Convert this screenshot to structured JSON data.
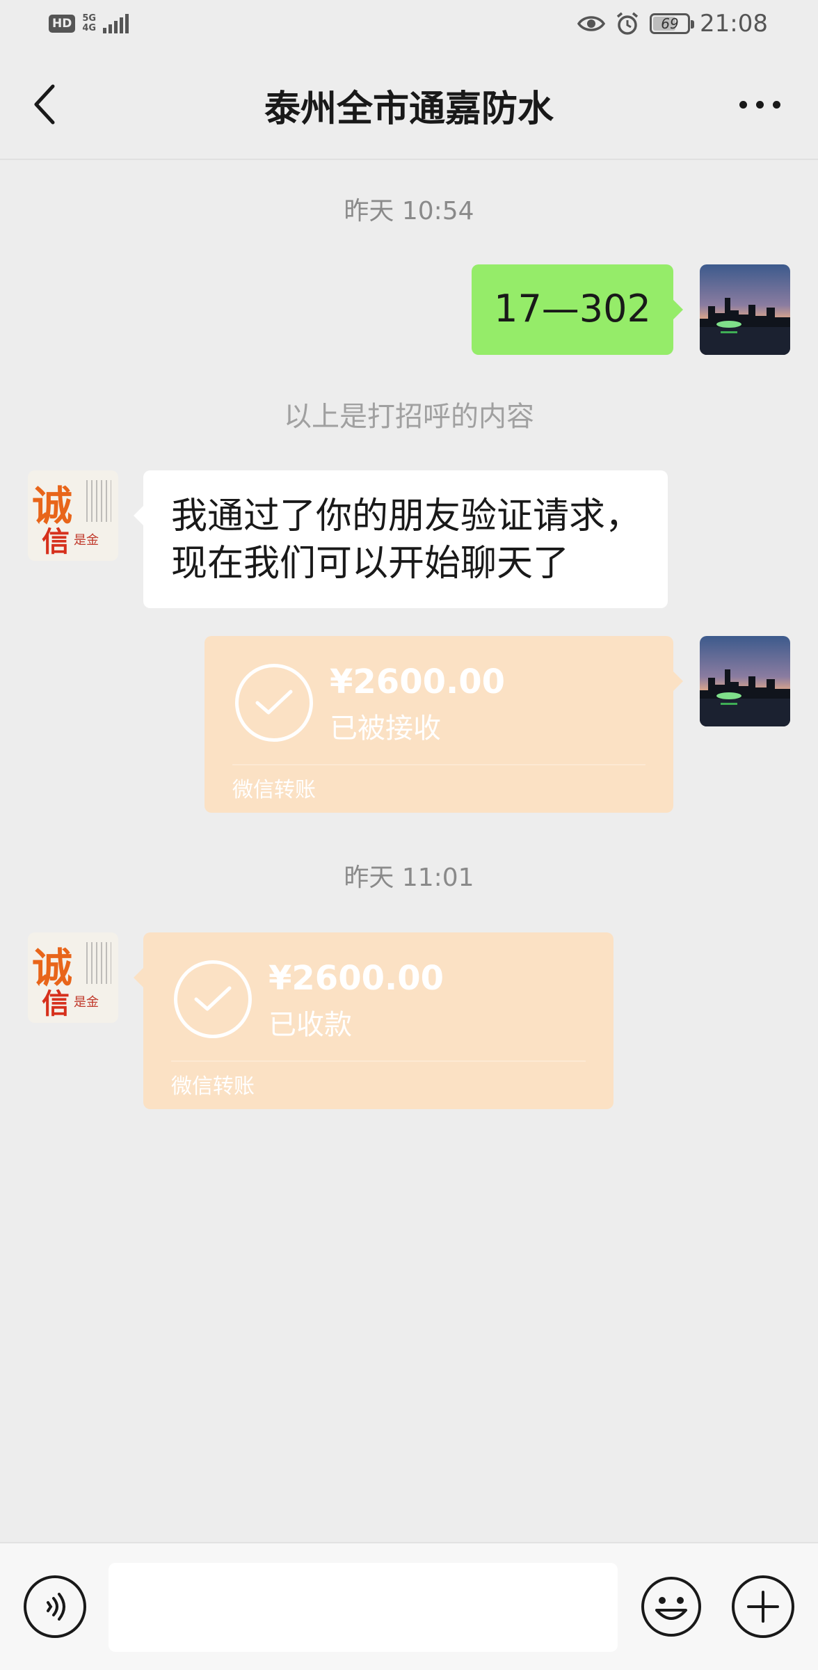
{
  "status_bar": {
    "hd": "HD",
    "network": "5G",
    "network_sub": "4G",
    "battery": "69",
    "battery_level": 0.69,
    "time": "21:08",
    "icons": [
      "eye-icon",
      "alarm-icon",
      "battery-icon"
    ]
  },
  "header": {
    "title": "泰州全市通嘉防水",
    "back_icon": "chevron-left-icon",
    "more_icon": "more-dots-icon"
  },
  "chat": {
    "time_1": "昨天 10:54",
    "msg_out_1": "17—302",
    "system_msg": "以上是打招呼的内容",
    "msg_in_1": "我通过了你的朋友验证请求，现在我们可以开始聊天了",
    "transfer_1": {
      "amount": "¥2600.00",
      "status": "已被接收",
      "footer": "微信转账"
    },
    "time_2": "昨天 11:01",
    "transfer_2": {
      "amount": "¥2600.00",
      "status": "已收款",
      "footer": "微信转账"
    },
    "contact_avatar_text": {
      "main": "诚",
      "sub": "信",
      "tag": "是金"
    }
  },
  "input_bar": {
    "placeholder": "",
    "icons": [
      "voice-icon",
      "emoji-icon",
      "plus-icon"
    ]
  },
  "colors": {
    "background": "#ededed",
    "outgoing_bubble": "#95ec69",
    "incoming_bubble": "#ffffff",
    "transfer_bubble": "#fbe1c4"
  }
}
